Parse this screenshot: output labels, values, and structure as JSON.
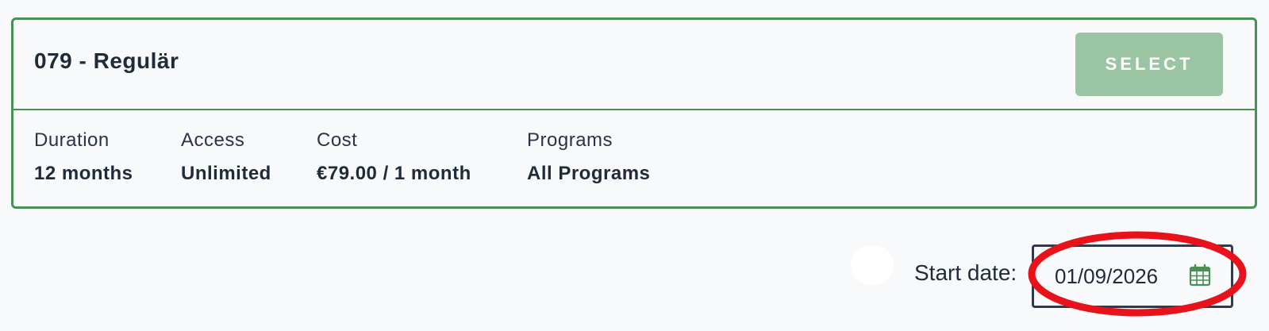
{
  "plan": {
    "title": "079 - Regulär",
    "select_label": "SELECT",
    "details": [
      {
        "label": "Duration",
        "value": "12 months"
      },
      {
        "label": "Access",
        "value": "Unlimited"
      },
      {
        "label": "Cost",
        "value": "€79.00 / 1 month"
      },
      {
        "label": "Programs",
        "value": "All Programs"
      }
    ]
  },
  "start_date": {
    "label": "Start date:",
    "value": "01/09/2026"
  },
  "colors": {
    "accent_green": "#4a8f55",
    "button_green": "#9bc4a2",
    "annotation_red": "#e8121a",
    "background": "#f8f9fb"
  },
  "icons": [
    "calendar-icon"
  ]
}
